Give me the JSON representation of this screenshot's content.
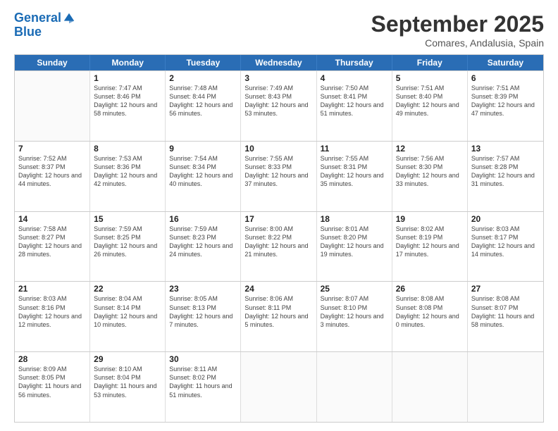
{
  "header": {
    "logo_line1": "General",
    "logo_line2": "Blue",
    "title": "September 2025",
    "subtitle": "Comares, Andalusia, Spain"
  },
  "weekdays": [
    "Sunday",
    "Monday",
    "Tuesday",
    "Wednesday",
    "Thursday",
    "Friday",
    "Saturday"
  ],
  "weeks": [
    [
      {
        "day": "",
        "empty": true
      },
      {
        "day": "1",
        "sunrise": "7:47 AM",
        "sunset": "8:46 PM",
        "daylight": "12 hours and 58 minutes."
      },
      {
        "day": "2",
        "sunrise": "7:48 AM",
        "sunset": "8:44 PM",
        "daylight": "12 hours and 56 minutes."
      },
      {
        "day": "3",
        "sunrise": "7:49 AM",
        "sunset": "8:43 PM",
        "daylight": "12 hours and 53 minutes."
      },
      {
        "day": "4",
        "sunrise": "7:50 AM",
        "sunset": "8:41 PM",
        "daylight": "12 hours and 51 minutes."
      },
      {
        "day": "5",
        "sunrise": "7:51 AM",
        "sunset": "8:40 PM",
        "daylight": "12 hours and 49 minutes."
      },
      {
        "day": "6",
        "sunrise": "7:51 AM",
        "sunset": "8:39 PM",
        "daylight": "12 hours and 47 minutes."
      }
    ],
    [
      {
        "day": "7",
        "sunrise": "7:52 AM",
        "sunset": "8:37 PM",
        "daylight": "12 hours and 44 minutes."
      },
      {
        "day": "8",
        "sunrise": "7:53 AM",
        "sunset": "8:36 PM",
        "daylight": "12 hours and 42 minutes."
      },
      {
        "day": "9",
        "sunrise": "7:54 AM",
        "sunset": "8:34 PM",
        "daylight": "12 hours and 40 minutes."
      },
      {
        "day": "10",
        "sunrise": "7:55 AM",
        "sunset": "8:33 PM",
        "daylight": "12 hours and 37 minutes."
      },
      {
        "day": "11",
        "sunrise": "7:55 AM",
        "sunset": "8:31 PM",
        "daylight": "12 hours and 35 minutes."
      },
      {
        "day": "12",
        "sunrise": "7:56 AM",
        "sunset": "8:30 PM",
        "daylight": "12 hours and 33 minutes."
      },
      {
        "day": "13",
        "sunrise": "7:57 AM",
        "sunset": "8:28 PM",
        "daylight": "12 hours and 31 minutes."
      }
    ],
    [
      {
        "day": "14",
        "sunrise": "7:58 AM",
        "sunset": "8:27 PM",
        "daylight": "12 hours and 28 minutes."
      },
      {
        "day": "15",
        "sunrise": "7:59 AM",
        "sunset": "8:25 PM",
        "daylight": "12 hours and 26 minutes."
      },
      {
        "day": "16",
        "sunrise": "7:59 AM",
        "sunset": "8:23 PM",
        "daylight": "12 hours and 24 minutes."
      },
      {
        "day": "17",
        "sunrise": "8:00 AM",
        "sunset": "8:22 PM",
        "daylight": "12 hours and 21 minutes."
      },
      {
        "day": "18",
        "sunrise": "8:01 AM",
        "sunset": "8:20 PM",
        "daylight": "12 hours and 19 minutes."
      },
      {
        "day": "19",
        "sunrise": "8:02 AM",
        "sunset": "8:19 PM",
        "daylight": "12 hours and 17 minutes."
      },
      {
        "day": "20",
        "sunrise": "8:03 AM",
        "sunset": "8:17 PM",
        "daylight": "12 hours and 14 minutes."
      }
    ],
    [
      {
        "day": "21",
        "sunrise": "8:03 AM",
        "sunset": "8:16 PM",
        "daylight": "12 hours and 12 minutes."
      },
      {
        "day": "22",
        "sunrise": "8:04 AM",
        "sunset": "8:14 PM",
        "daylight": "12 hours and 10 minutes."
      },
      {
        "day": "23",
        "sunrise": "8:05 AM",
        "sunset": "8:13 PM",
        "daylight": "12 hours and 7 minutes."
      },
      {
        "day": "24",
        "sunrise": "8:06 AM",
        "sunset": "8:11 PM",
        "daylight": "12 hours and 5 minutes."
      },
      {
        "day": "25",
        "sunrise": "8:07 AM",
        "sunset": "8:10 PM",
        "daylight": "12 hours and 3 minutes."
      },
      {
        "day": "26",
        "sunrise": "8:08 AM",
        "sunset": "8:08 PM",
        "daylight": "12 hours and 0 minutes."
      },
      {
        "day": "27",
        "sunrise": "8:08 AM",
        "sunset": "8:07 PM",
        "daylight": "11 hours and 58 minutes."
      }
    ],
    [
      {
        "day": "28",
        "sunrise": "8:09 AM",
        "sunset": "8:05 PM",
        "daylight": "11 hours and 56 minutes."
      },
      {
        "day": "29",
        "sunrise": "8:10 AM",
        "sunset": "8:04 PM",
        "daylight": "11 hours and 53 minutes."
      },
      {
        "day": "30",
        "sunrise": "8:11 AM",
        "sunset": "8:02 PM",
        "daylight": "11 hours and 51 minutes."
      },
      {
        "day": "",
        "empty": true
      },
      {
        "day": "",
        "empty": true
      },
      {
        "day": "",
        "empty": true
      },
      {
        "day": "",
        "empty": true
      }
    ]
  ]
}
